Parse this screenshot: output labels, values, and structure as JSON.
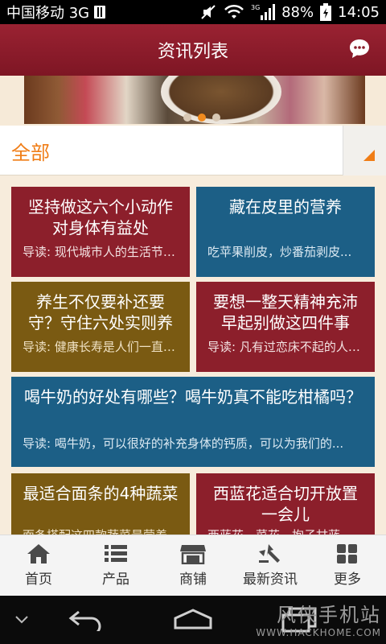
{
  "status_bar": {
    "carrier": "中国移动 3G",
    "network": "3G",
    "battery": "88%",
    "time": "14:05"
  },
  "header": {
    "title": "资讯列表",
    "chat_icon": "chat-bubble-icon"
  },
  "banner": {
    "slide_count": 3,
    "active_slide": 1
  },
  "category": {
    "current": "全部"
  },
  "articles": [
    {
      "title": "坚持做这六个小动作对身体有益处",
      "lead": "导读: 现代城市人的生活节奏快...",
      "color": "#8c1f2b"
    },
    {
      "title": "藏在皮里的营养",
      "lead": "吃苹果削皮，炒番茄剥皮...",
      "color": "#1c5f86"
    },
    {
      "title": "养生不仅要补还要守？守住六处实则养",
      "lead": "导读: 健康长寿是人们一直追求的...",
      "color": "#7a5a12"
    },
    {
      "title": "要想一整天精神充沛早起别做这四件事",
      "lead": "导读: 凡有过恋床不起的人都知道...",
      "color": "#8c1f2b"
    },
    {
      "title": "喝牛奶的好处有哪些？喝牛奶真不能吃柑橘吗？",
      "lead": "导读: 喝牛奶，可以很好的补充身体的钙质，可以为我们的...",
      "color": "#1c5f86"
    },
    {
      "title": "最适合面条的4种蔬菜",
      "lead": "面条搭配这四款蔬菜最营养",
      "color": "#7a5a12"
    },
    {
      "title": "西蓝花适合切开放置一会儿",
      "lead": "西蓝花、菜花、抱子甘蓝",
      "color": "#8c1f2b"
    }
  ],
  "tabs": [
    {
      "label": "首页",
      "icon": "home-icon"
    },
    {
      "label": "产品",
      "icon": "list-icon"
    },
    {
      "label": "商铺",
      "icon": "shop-icon"
    },
    {
      "label": "最新资讯",
      "icon": "news-icon"
    },
    {
      "label": "更多",
      "icon": "grid-icon"
    }
  ],
  "watermark": {
    "name": "风侠手机站",
    "url": "WWW.HACKHOME.COM"
  }
}
